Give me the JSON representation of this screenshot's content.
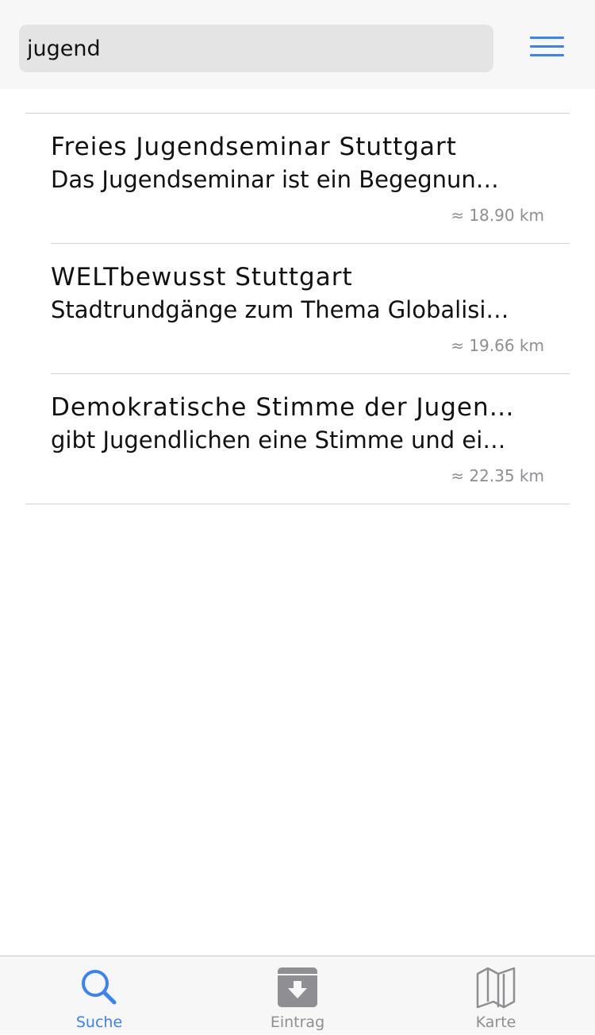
{
  "search": {
    "value": "jugend"
  },
  "header": {
    "menu_icon": "hamburger-menu-icon",
    "accent_color": "#3b82f6"
  },
  "results": [
    {
      "title": "Freies Jugendseminar Stuttgart",
      "description": "Das Jugendseminar ist ein Begegnun…",
      "distance": "≈ 18.90 km"
    },
    {
      "title": "WELTbewusst Stuttgart",
      "description": "Stadtrundgänge zum Thema Globalisi…",
      "distance": "≈ 19.66 km"
    },
    {
      "title": "Demokratische Stimme der Jugen…",
      "description": "gibt Jugendlichen eine Stimme und ei…",
      "distance": "≈ 22.35 km"
    }
  ],
  "tabbar": {
    "tabs": [
      {
        "label": "Suche",
        "icon": "search-icon",
        "active": true
      },
      {
        "label": "Eintrag",
        "icon": "archive-download-icon",
        "active": false
      },
      {
        "label": "Karte",
        "icon": "map-icon",
        "active": false
      }
    ]
  },
  "colors": {
    "accent": "#3b82f6",
    "inactive": "#8e8e93",
    "divider": "#d2d2d2"
  }
}
